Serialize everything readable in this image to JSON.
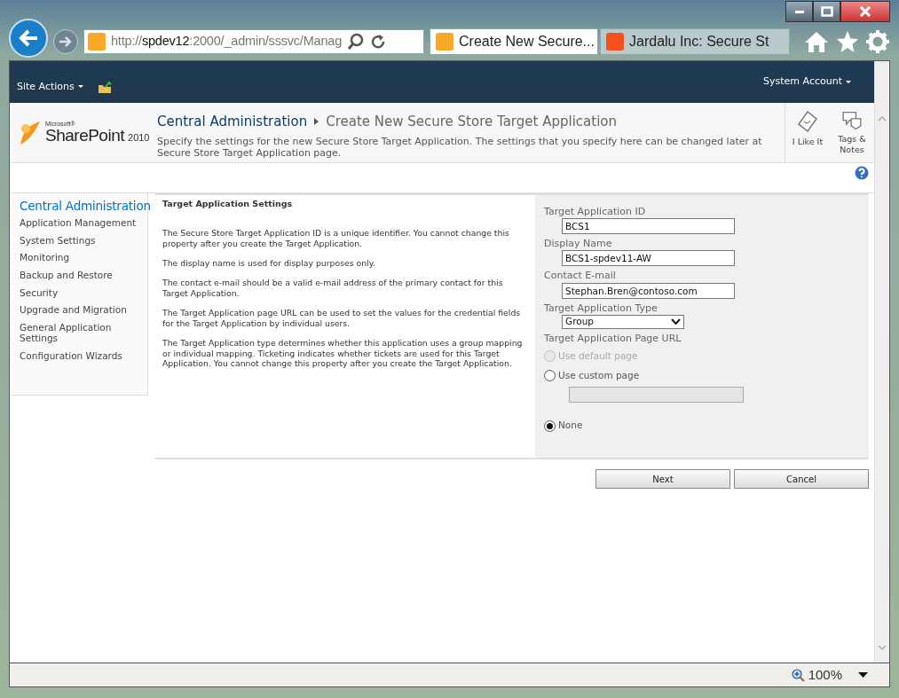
{
  "browser": {
    "address": {
      "scheme": "http://",
      "host": "spdev12",
      "path": ":2000/_admin/sssvc/Manag"
    },
    "tabs": [
      {
        "title": "Create New Secure...",
        "selected": true,
        "kind": "sharepoint"
      },
      {
        "title": "Jardalu Inc: Secure St",
        "selected": false,
        "kind": "blog"
      }
    ],
    "zoom": "100%"
  },
  "ribbon": {
    "site_actions": "Site Actions",
    "user": "System Account"
  },
  "header": {
    "logo": {
      "maker": "Microsoft®",
      "product": "SharePoint",
      "version": "2010"
    },
    "breadcrumb": [
      "Central Administration",
      "Create New Secure Store Target Application"
    ],
    "description": "Specify the settings for the new Secure Store Target Application. The settings that you specify here can be changed later at Secure Store Target Application page.",
    "social": [
      {
        "label": "I Like It",
        "kind": "like"
      },
      {
        "label": "Tags & Notes",
        "kind": "tags"
      }
    ]
  },
  "quick_launch": {
    "heading": "Central Administration",
    "items": [
      "Application Management",
      "System Settings",
      "Monitoring",
      "Backup and Restore",
      "Security",
      "Upgrade and Migration",
      "General Application Settings",
      "Configuration Wizards"
    ]
  },
  "section": {
    "title": "Target Application Settings",
    "paragraphs": [
      "The Secure Store Target Application ID is a unique identifier. You cannot change this property after you create the Target Application.",
      "The display name is used for display purposes only.",
      "The contact e-mail should be a valid e-mail address of the primary contact for this Target Application.",
      "The Target Application page URL can be used to set the values for the credential fields for the Target Application by individual users.",
      "The Target Application type determines whether this application uses a group mapping or individual mapping. Ticketing indicates whether tickets are used for this Target Application. You cannot change this property after you create the Target Application."
    ]
  },
  "form": [
    {
      "kind": "text",
      "label": "Target Application ID",
      "value": "BCS1"
    },
    {
      "kind": "text",
      "label": "Display Name",
      "value": "BCS1-spdev11-AW"
    },
    {
      "kind": "text",
      "label": "Contact E-mail",
      "value": "Stephan.Bren@contoso.com"
    },
    {
      "kind": "select",
      "label": "Target Application Type",
      "value": "Group"
    },
    {
      "kind": "radio",
      "label": "Target Application Page URL",
      "options": [
        {
          "label": "Use default page",
          "selected": false,
          "disabled": true
        },
        {
          "label": "Use custom page",
          "selected": false,
          "disabled": false,
          "url_field": {
            "disabled": true
          }
        },
        {
          "label": "None",
          "selected": true,
          "disabled": false
        }
      ]
    }
  ],
  "buttons": [
    "Next",
    "Cancel"
  ]
}
